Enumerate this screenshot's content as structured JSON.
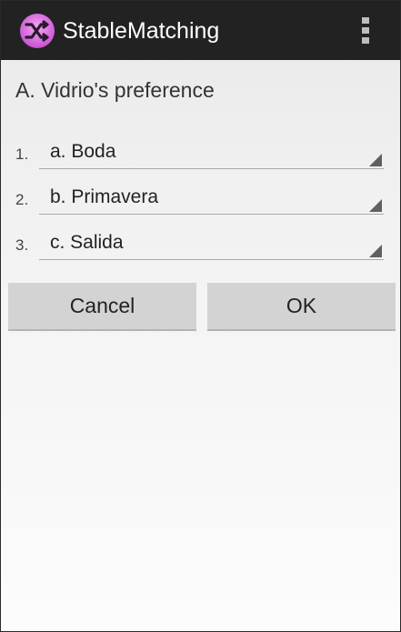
{
  "action_bar": {
    "title": "StableMatching",
    "icon": "shuffle-icon",
    "menu_icon": "overflow-menu-icon",
    "background": "#222222",
    "icon_color": "#e066e6"
  },
  "dialog": {
    "heading": "A. Vidrio's preference",
    "preferences": [
      {
        "rank": "1.",
        "value": "a. Boda"
      },
      {
        "rank": "2.",
        "value": "b. Primavera"
      },
      {
        "rank": "3.",
        "value": "c. Salida"
      }
    ],
    "cancel_label": "Cancel",
    "ok_label": "OK"
  }
}
